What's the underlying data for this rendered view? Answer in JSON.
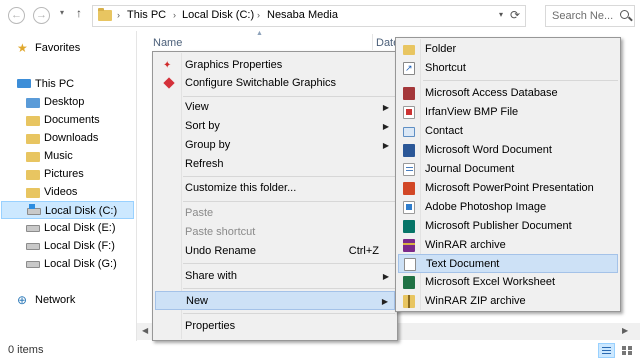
{
  "address": {
    "back_glyph": "←",
    "forward_glyph": "→",
    "up_glyph": "↑",
    "dropdown_glyph": "▾",
    "separator_glyph": "›",
    "breadcrumbs": [
      "This PC",
      "Local Disk (C:)",
      "Nesaba Media"
    ],
    "refresh_glyph": "⟳",
    "search_placeholder": "Search Ne..."
  },
  "nav": {
    "items": [
      {
        "label": "Favorites",
        "icon": "star-icon"
      },
      {
        "label": "This PC",
        "icon": "computer-icon"
      },
      {
        "label": "Desktop",
        "icon": "folder-icon"
      },
      {
        "label": "Documents",
        "icon": "folder-icon"
      },
      {
        "label": "Downloads",
        "icon": "folder-icon"
      },
      {
        "label": "Music",
        "icon": "folder-icon"
      },
      {
        "label": "Pictures",
        "icon": "folder-icon"
      },
      {
        "label": "Videos",
        "icon": "folder-icon"
      },
      {
        "label": "Local Disk (C:)",
        "icon": "drive-icon",
        "selected": true
      },
      {
        "label": "Local Disk (E:)",
        "icon": "drive-icon"
      },
      {
        "label": "Local Disk (F:)",
        "icon": "drive-icon"
      },
      {
        "label": "Local Disk (G:)",
        "icon": "drive-icon"
      },
      {
        "label": "Network",
        "icon": "network-icon"
      }
    ]
  },
  "content": {
    "columns": [
      "Name",
      "Date"
    ],
    "sort_glyph": "▲"
  },
  "scrollbar": {
    "left_glyph": "◀",
    "right_glyph": "▶"
  },
  "status": {
    "item_count": "0 items"
  },
  "context_menu": {
    "arrow_glyph": "▶",
    "items": {
      "graphics_properties": "Graphics Properties",
      "configure_graphics": "Configure Switchable Graphics",
      "view": "View",
      "sort_by": "Sort by",
      "group_by": "Group by",
      "refresh": "Refresh",
      "customize": "Customize this folder...",
      "paste": "Paste",
      "paste_shortcut": "Paste shortcut",
      "undo_rename": "Undo Rename",
      "undo_shortcut": "Ctrl+Z",
      "share_with": "Share with",
      "new": "New",
      "properties": "Properties"
    }
  },
  "new_submenu": {
    "folder": "Folder",
    "shortcut": "Shortcut",
    "access": "Microsoft Access Database",
    "bmp": "IrfanView BMP File",
    "contact": "Contact",
    "word": "Microsoft Word Document",
    "journal": "Journal Document",
    "powerpoint": "Microsoft PowerPoint Presentation",
    "photoshop": "Adobe Photoshop Image",
    "publisher": "Microsoft Publisher Document",
    "winrar": "WinRAR archive",
    "text": "Text Document",
    "excel": "Microsoft Excel Worksheet",
    "winrar_zip": "WinRAR ZIP archive"
  }
}
